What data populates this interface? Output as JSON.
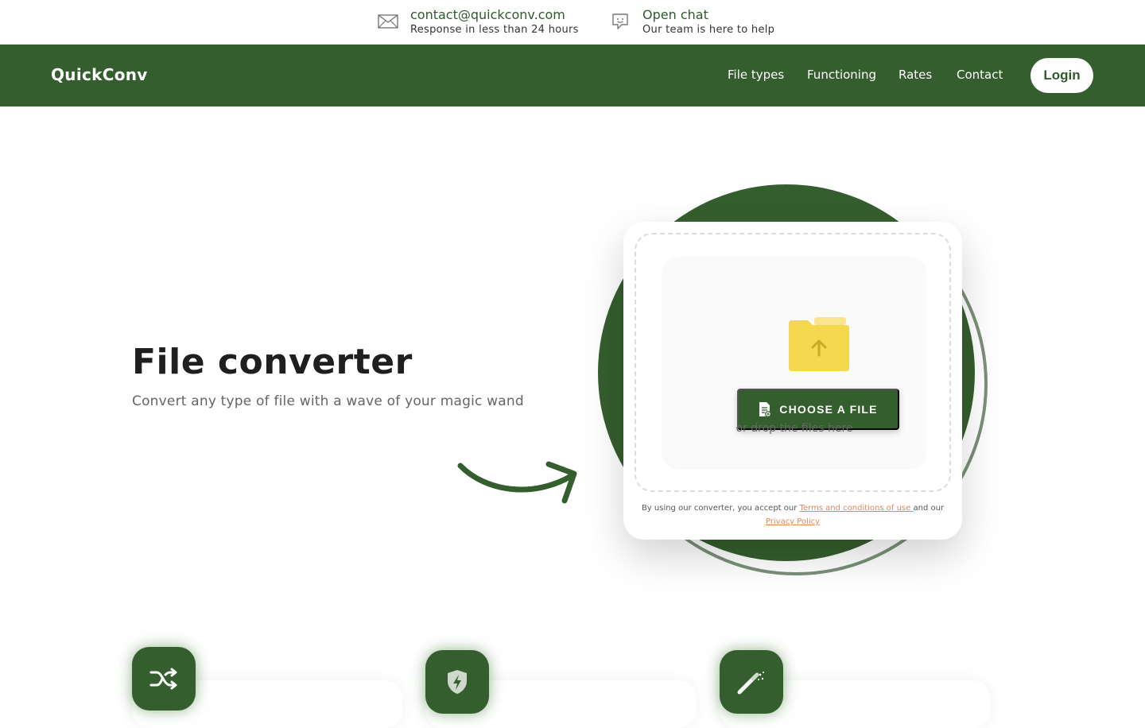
{
  "topbar": {
    "email": {
      "main": "contact@quickconv.com",
      "sub": "Response in less than 24 hours",
      "icon": "envelope-icon"
    },
    "chat": {
      "main": "Open chat",
      "sub": "Our team is here to help",
      "icon": "chat-bubble-icon"
    }
  },
  "navbar": {
    "brand": "QuickConv",
    "links": [
      "File types",
      "Functioning",
      "Rates",
      "Contact"
    ],
    "login": "Login"
  },
  "hero": {
    "title": "File converter",
    "subtitle": "Convert any type of file with a wave of your magic wand"
  },
  "uploader": {
    "choose_label": "CHOOSE A FILE",
    "drop_text": "or drop the files here",
    "terms_prefix": "By using our converter, you accept our ",
    "terms_link": "Terms and conditions of use ",
    "terms_middle": "and our",
    "privacy_link": "Privacy Policy"
  },
  "features": [
    {
      "icon": "shuffle-icon"
    },
    {
      "icon": "shield-bolt-icon"
    },
    {
      "icon": "magic-wand-icon"
    }
  ],
  "colors": {
    "brand_green": "#355e2e",
    "accent_orange": "#e0895b",
    "folder_yellow": "#f6d84e"
  }
}
